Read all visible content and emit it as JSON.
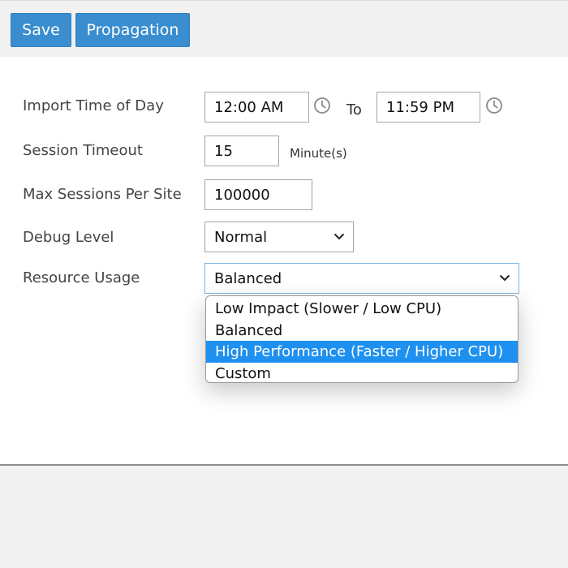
{
  "toolbar": {
    "save_label": "Save",
    "propagation_label": "Propagation"
  },
  "form": {
    "import_time": {
      "label": "Import Time of Day",
      "start_value": "12:00 AM",
      "to_label": "To",
      "end_value": "11:59 PM",
      "icon": "clock-icon"
    },
    "session_timeout": {
      "label": "Session Timeout",
      "value": "15",
      "unit": "Minute(s)"
    },
    "max_sessions": {
      "label": "Max Sessions Per Site",
      "value": "100000"
    },
    "debug_level": {
      "label": "Debug Level",
      "value": "Normal"
    },
    "resource_usage": {
      "label": "Resource Usage",
      "value": "Balanced",
      "options": [
        "Low Impact (Slower / Low CPU)",
        "Balanced",
        "High Performance (Faster / Higher CPU)",
        "Custom"
      ],
      "highlighted_index": 2
    }
  },
  "colors": {
    "button_bg": "#3a8ecf",
    "highlight": "#1e90f0"
  }
}
